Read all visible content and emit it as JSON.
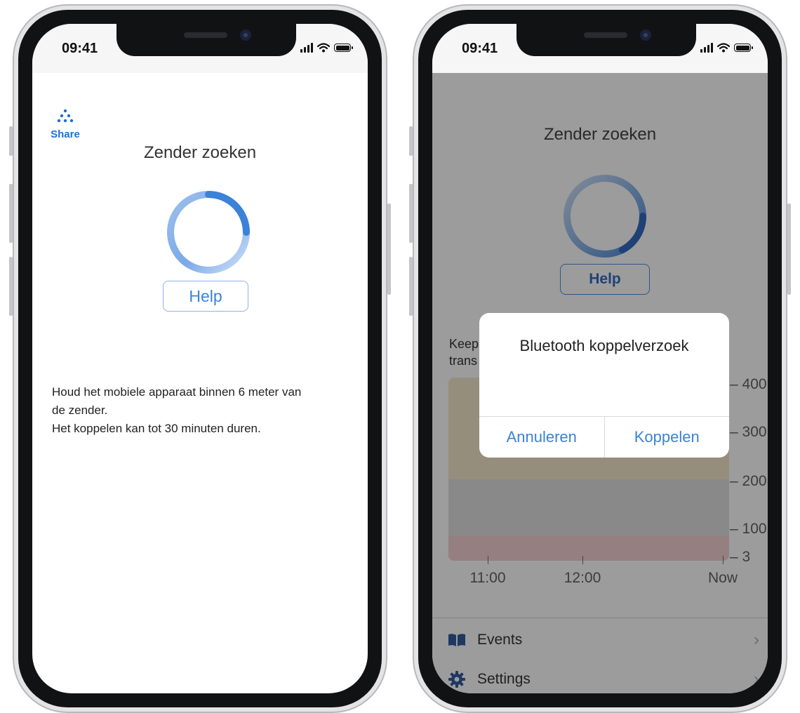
{
  "left_screen": {
    "status_time": "09:41",
    "share_label": "Share",
    "title": "Zender zoeken",
    "help_label": "Help",
    "info_lines": [
      "Houd het mobiele apparaat binnen 6 meter van",
      "de zender.",
      "Het koppelen kan tot 30 minuten duren."
    ]
  },
  "right_screen": {
    "status_time": "09:41",
    "title": "Zender zoeken",
    "help_label": "Help",
    "chart_text_partial": [
      "Keep",
      "trans"
    ],
    "chart_y_ticks": [
      "400",
      "300",
      "200",
      "100",
      "3"
    ],
    "chart_x_ticks": [
      "11:00",
      "12:00",
      "Now"
    ],
    "list_items": [
      {
        "label": "Events",
        "icon": "book-icon"
      },
      {
        "label": "Settings",
        "icon": "gear-icon"
      }
    ],
    "dialog": {
      "title": "Bluetooth koppelverzoek",
      "cancel_label": "Annuleren",
      "confirm_label": "Koppelen"
    }
  },
  "colors": {
    "accent": "#3b82d8",
    "share_blue": "#1f6fd6"
  }
}
